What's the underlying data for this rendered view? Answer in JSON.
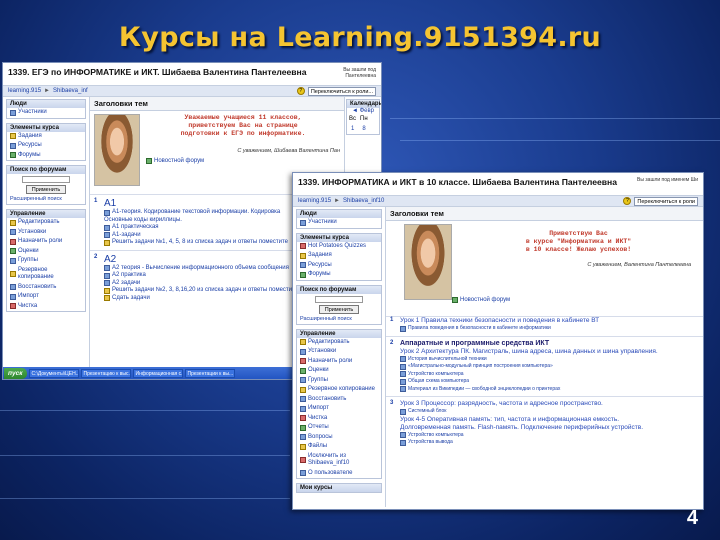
{
  "slide": {
    "title": "Курсы на Learning.9151394.ru",
    "number": "4"
  },
  "colors": {
    "background": "#1a3c8e",
    "title": "#f5c431",
    "link": "#1a3ea6",
    "greeting": "#c0392b"
  },
  "shot1": {
    "course_title": "1339. ЕГЭ по ИНФОРМАТИКЕ и ИКТ. Шибаева Валентина Пантелеевна",
    "login_line1": "Вы зашли под",
    "login_line2": "Пантелеевна",
    "breadcrumb": [
      "learning.915",
      "Shibaeva_inf"
    ],
    "switch_role": "Переключиться к роли...",
    "people": {
      "header": "Люди",
      "items": [
        "Участники"
      ]
    },
    "elements": {
      "header": "Элементы курса",
      "items": [
        "Задания",
        "Ресурсы",
        "Форумы"
      ]
    },
    "search": {
      "header": "Поиск по форумам",
      "button": "Применить",
      "advanced": "Расширенный поиск"
    },
    "admin": {
      "header": "Управление",
      "items": [
        "Редактировать",
        "Установки",
        "Назначить роли",
        "Оценки",
        "Группы",
        "Резервное копирование",
        "Восстановить",
        "Импорт",
        "Чистка"
      ]
    },
    "topics_header": "Заголовки тем",
    "greeting": [
      "Уважаемые учащиеся 11 классов,",
      "приветствуем Вас на странице",
      "подготовки к ЕГЭ по информатике."
    ],
    "signature": "С уважением, Шибаева Валентина Пан",
    "news": "Новостной форум",
    "calendar": {
      "header": "Календарь",
      "month": "Февр",
      "weekdays": [
        "Вс",
        "Пн"
      ],
      "days": [
        "1",
        "8"
      ]
    },
    "sections": [
      {
        "num": "1",
        "title": "А1",
        "items": [
          "А1-теория. Кодирование текстовой информации. Кодировка",
          "Основные коды кириллицы.",
          "А1 практическая",
          "А1-задачи",
          "Решить задачи №1, 4, 5, 8 из списка задач и ответы поместите"
        ]
      },
      {
        "num": "2",
        "title": "А2",
        "items": [
          "А2 теория - Вычисление информационного объема сообщения",
          "А2 практика",
          "А2 задачи",
          "Решить задачи №2, 3, 8,16,20 из списка задач и ответы поместите",
          "Сдать задачи"
        ]
      }
    ],
    "taskbar": {
      "start": "пуск",
      "tasks": [
        "С:\\Документы\\ЦЕН...",
        "Презентацию к выс...",
        "Информационная с...",
        "Презентации к вы..."
      ]
    }
  },
  "shot2": {
    "course_title": "1339. ИНФОРМАТИКА и ИКТ в 10 классе. Шибаева Валентина Пантелеевна",
    "login_line1": "Вы зашли под именем Ши",
    "breadcrumb": [
      "learning.915",
      "Shibaeva_inf10"
    ],
    "switch_role": "Переключиться к роли",
    "people": {
      "header": "Люди",
      "items": [
        "Участники"
      ]
    },
    "elements": {
      "header": "Элементы курса",
      "items": [
        "Hot Potatoes Quizzes",
        "Задания",
        "Ресурсы",
        "Форумы"
      ]
    },
    "search": {
      "header": "Поиск по форумам",
      "button": "Применить",
      "advanced": "Расширенный поиск"
    },
    "admin": {
      "header": "Управление",
      "items": [
        "Редактировать",
        "Установки",
        "Назначить роли",
        "Оценки",
        "Группы",
        "Резервное копирование",
        "Восстановить",
        "Импорт",
        "Чистка",
        "Отчеты",
        "Вопросы",
        "Файлы",
        "Исключить из Shibaeva_inf10",
        "О пользователе"
      ]
    },
    "my_courses": "Мои курсы",
    "topics_header": "Заголовки тем",
    "greeting": [
      "Приветствую Вас",
      "в курсе \"Информатика и ИКТ\"",
      "в 10 классе! Желаю успехов!"
    ],
    "signature": "С уважением, Валентина Пантелеевна",
    "news": "Новостной форум",
    "sections": [
      {
        "num": "1",
        "lines": [
          "Урок 1 Правила техники безопасности и поведения в кабинете ВТ"
        ],
        "items": [
          "Правила поведения в безопасности в кабинете информатики"
        ]
      },
      {
        "num": "2",
        "lines": [
          "Аппаратные и программные средства ИКТ",
          "Урок 2 Архитектура ПК. Магистраль, шина адреса, шина данных и шина управления."
        ],
        "items": [
          "История вычислительной техники",
          "«Магистрально-модульный принцип построения компьютера»",
          "Устройство компьютера",
          "Общая схема компьютера",
          "Материал из Википедии — свободной энциклопедии о принтерах"
        ]
      },
      {
        "num": "3",
        "lines": [
          "Урок 3 Процессор: разрядность, частота и адресное пространство.",
          "Системный блок",
          "Урок 4-5 Оперативная память: тип, частота и информационная емкость.",
          "Долговременная память. Flash-память. Подключение периферийных устройств."
        ],
        "items": [
          "Устройство компьютера",
          "Устройства вывода"
        ]
      }
    ]
  }
}
